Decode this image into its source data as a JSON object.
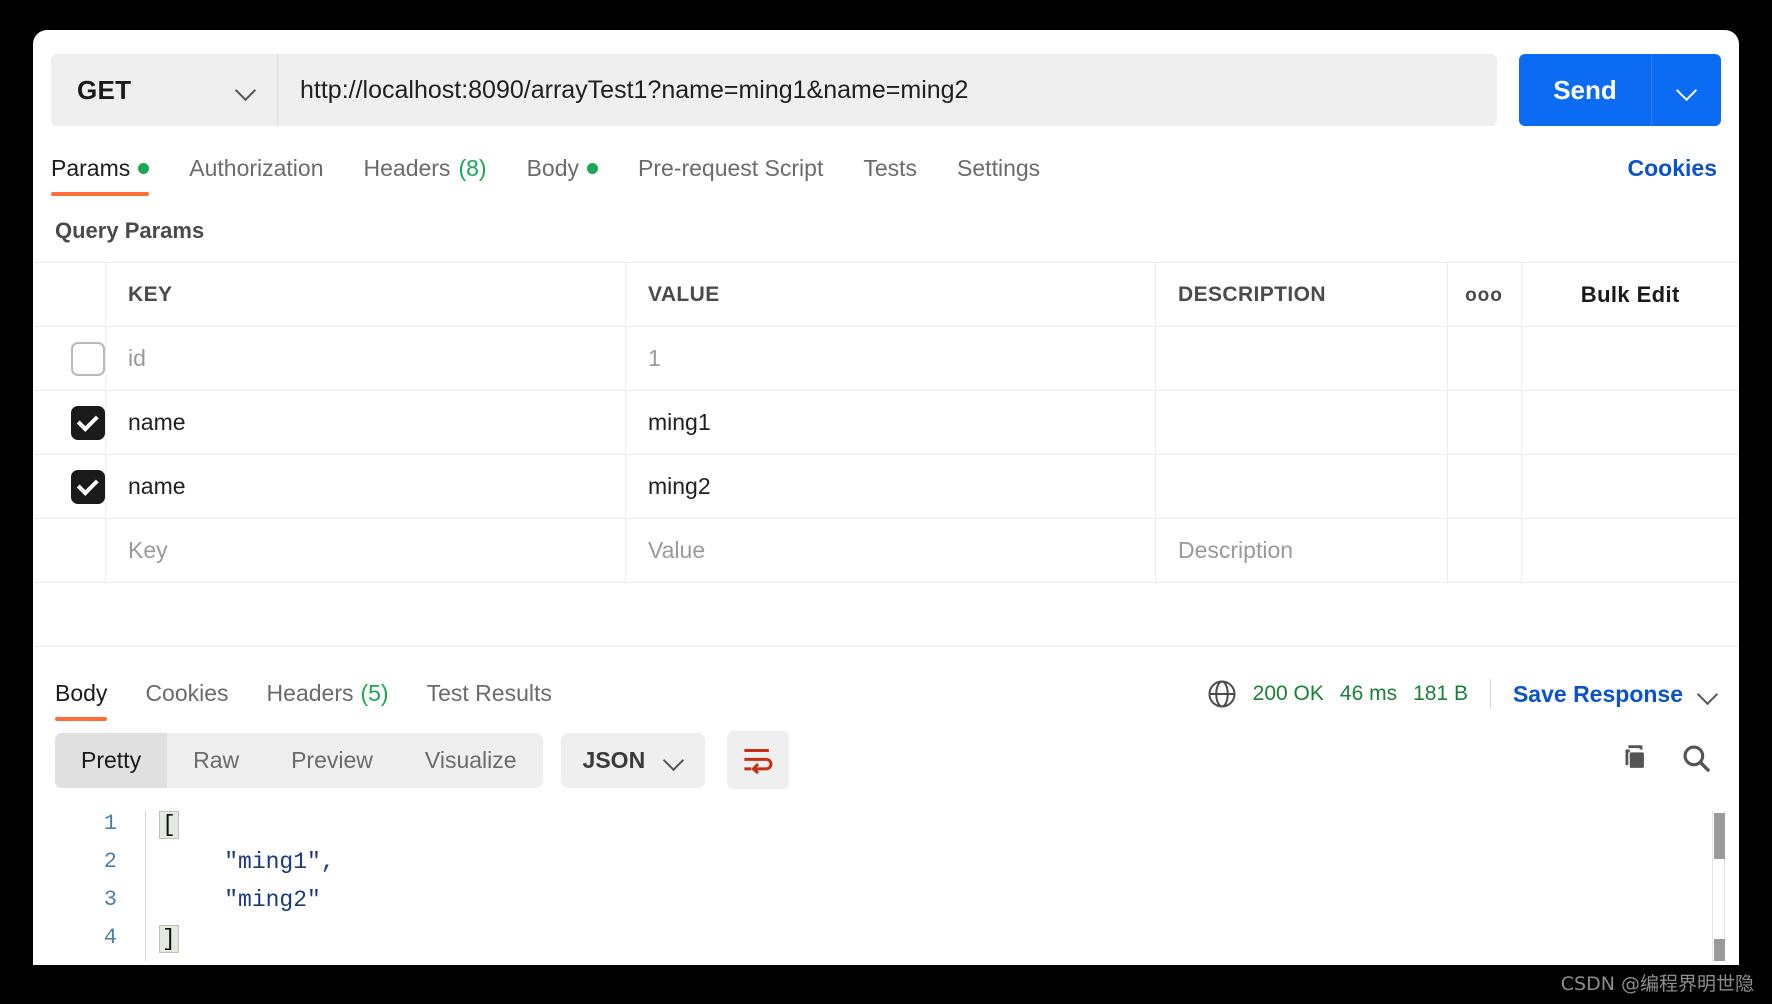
{
  "request": {
    "method": "GET",
    "method_caret_icon": "chevron-down-icon",
    "url": "http://localhost:8090/arrayTest1?name=ming1&name=ming2",
    "send_label": "Send",
    "send_caret_icon": "chevron-down-icon"
  },
  "request_tabs": [
    {
      "label": "Params",
      "badge": "dot",
      "active": true
    },
    {
      "label": "Authorization",
      "badge": "",
      "active": false
    },
    {
      "label": "Headers",
      "badge": "(8)",
      "active": false
    },
    {
      "label": "Body",
      "badge": "dot",
      "active": false
    },
    {
      "label": "Pre-request Script",
      "badge": "",
      "active": false
    },
    {
      "label": "Tests",
      "badge": "",
      "active": false
    },
    {
      "label": "Settings",
      "badge": "",
      "active": false
    }
  ],
  "cookies_link": "Cookies",
  "query_params": {
    "section_title": "Query Params",
    "columns": {
      "key": "KEY",
      "value": "VALUE",
      "description": "DESCRIPTION",
      "more_icon": "ooo",
      "bulk_edit": "Bulk Edit"
    },
    "rows": [
      {
        "checked": false,
        "key": "id",
        "value": "1",
        "description": "",
        "muted": true
      },
      {
        "checked": true,
        "key": "name",
        "value": "ming1",
        "description": "",
        "muted": false
      },
      {
        "checked": true,
        "key": "name",
        "value": "ming2",
        "description": "",
        "muted": false
      }
    ],
    "placeholder_row": {
      "key": "Key",
      "value": "Value",
      "description": "Description"
    }
  },
  "response_tabs": [
    {
      "label": "Body",
      "badge": "",
      "active": true
    },
    {
      "label": "Cookies",
      "badge": "",
      "active": false
    },
    {
      "label": "Headers",
      "badge": "(5)",
      "active": false
    },
    {
      "label": "Test Results",
      "badge": "",
      "active": false
    }
  ],
  "response_status": {
    "globe_icon": "globe-icon",
    "status": "200 OK",
    "time": "46 ms",
    "size": "181 B",
    "save_response": "Save Response",
    "save_caret_icon": "chevron-down-icon"
  },
  "viewer": {
    "modes": [
      "Pretty",
      "Raw",
      "Preview",
      "Visualize"
    ],
    "active_mode": "Pretty",
    "format": "JSON",
    "format_caret_icon": "chevron-down-icon",
    "wrap_icon": "word-wrap-icon",
    "copy_icon": "copy-icon",
    "search_icon": "search-icon"
  },
  "response_body": {
    "lines": [
      {
        "num": "1",
        "bracket": "[",
        "text": ""
      },
      {
        "num": "2",
        "bracket": "",
        "text": "    \"ming1\","
      },
      {
        "num": "3",
        "bracket": "",
        "text": "    \"ming2\""
      },
      {
        "num": "4",
        "bracket": "]",
        "text": ""
      }
    ]
  },
  "watermark": "CSDN @编程界明世隐",
  "colors": {
    "accent_orange": "#ff6c37",
    "link_blue": "#0b52cc",
    "send_blue": "#0b6bf2",
    "status_green": "#1a7f37",
    "dot_green": "#18a957",
    "wrap_red": "#c62f14"
  }
}
